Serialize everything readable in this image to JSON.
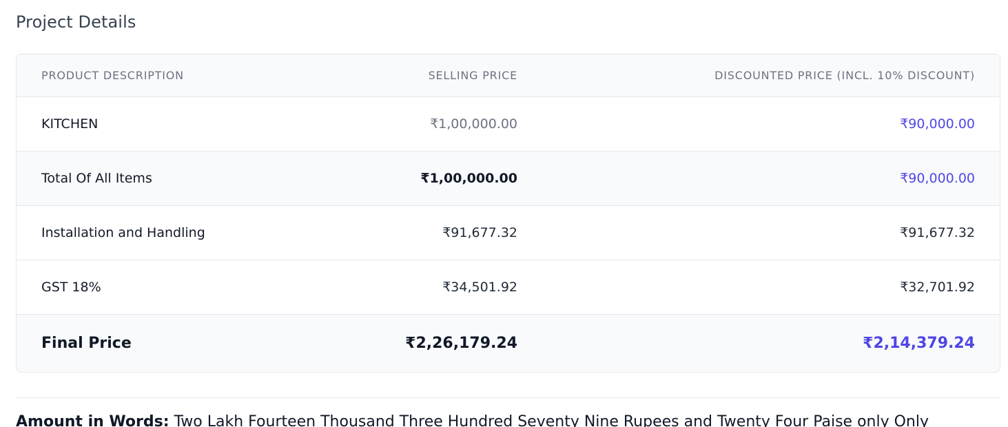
{
  "section_title": "Project Details",
  "table": {
    "headers": {
      "description": "PRODUCT DESCRIPTION",
      "selling_price": "SELLING PRICE",
      "discounted_price": "DISCOUNTED PRICE (INCL. 10% DISCOUNT)"
    },
    "rows": [
      {
        "description": "KITCHEN",
        "selling_price": "₹1,00,000.00",
        "discounted_price": "₹90,000.00"
      },
      {
        "description": "Total Of All Items",
        "selling_price": "₹1,00,000.00",
        "discounted_price": "₹90,000.00"
      },
      {
        "description": "Installation and Handling",
        "selling_price": "₹91,677.32",
        "discounted_price": "₹91,677.32"
      },
      {
        "description": "GST 18%",
        "selling_price": "₹34,501.92",
        "discounted_price": "₹32,701.92"
      },
      {
        "description": "Final Price",
        "selling_price": "₹2,26,179.24",
        "discounted_price": "₹2,14,379.24"
      }
    ]
  },
  "amount_in_words": {
    "label": "Amount in Words:",
    "value": " Two Lakh Fourteen Thousand Three Hundred Seventy Nine Rupees and Twenty Four Paise only Only"
  },
  "colors": {
    "accent": "#4f46e5",
    "header_bg": "#f9fafb",
    "border": "#e5e7eb",
    "muted_text": "#6b7280"
  }
}
